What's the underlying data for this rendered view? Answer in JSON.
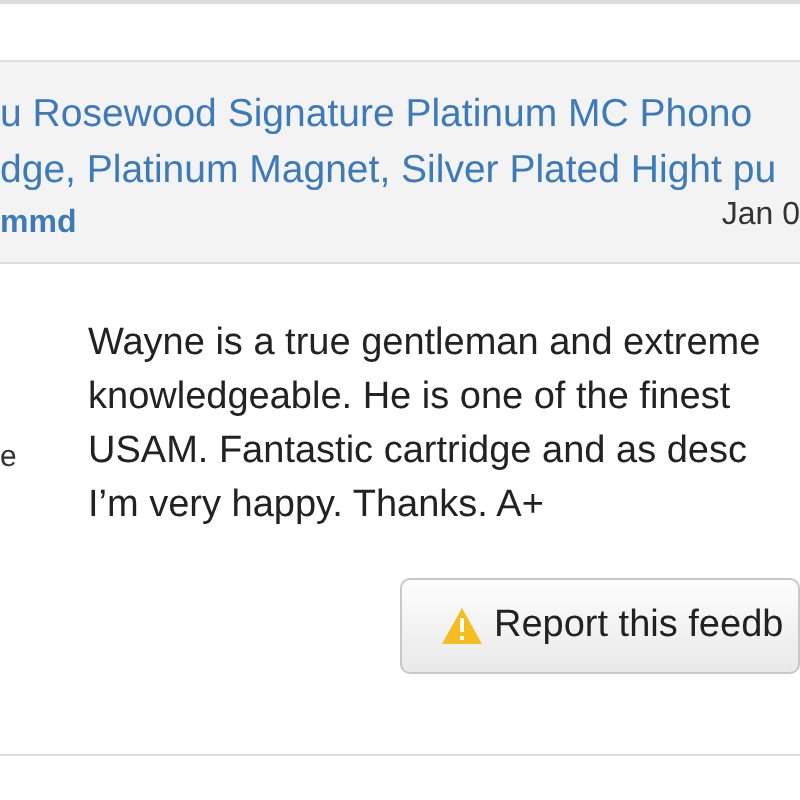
{
  "listing": {
    "title_lines": [
      "u Rosewood Signature Platinum MC Phono",
      "dge, Platinum Magnet, Silver Plated Hight pu"
    ],
    "author": "mmd",
    "date": "Jan 0"
  },
  "side_label": "e",
  "feedback": {
    "lines": [
      "Wayne is a true gentleman and extreme",
      "knowledgeable. He is one of the finest",
      "USAM. Fantastic cartridge and as desc",
      "I’m very happy. Thanks. A+"
    ]
  },
  "report_button": {
    "label": "Report this feedb"
  }
}
